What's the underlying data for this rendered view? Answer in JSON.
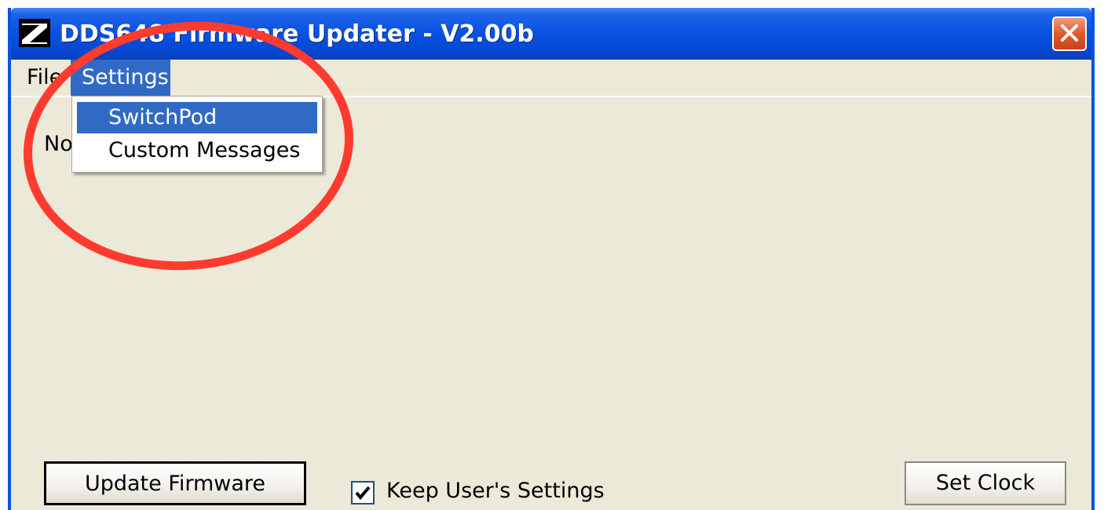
{
  "window": {
    "title": "DDS648 Firmware Updater - V2.00b",
    "icon": "app-logo-icon",
    "close_icon": "close-icon"
  },
  "menubar": {
    "file_label": "File",
    "settings_label": "Settings"
  },
  "settings_menu": {
    "items": [
      {
        "label": "SwitchPod",
        "highlighted": true
      },
      {
        "label": "Custom Messages",
        "highlighted": false
      }
    ]
  },
  "content": {
    "status_text": "No"
  },
  "controls": {
    "update_button": "Update Firmware",
    "keep_settings_label": "Keep User's Settings",
    "keep_settings_checked": true,
    "set_clock_button": "Set Clock"
  },
  "colors": {
    "titlebar": "#0a53e2",
    "menu_highlight": "#316ac5",
    "window_bg": "#ece9d8",
    "annotation": "#ff3b30"
  }
}
